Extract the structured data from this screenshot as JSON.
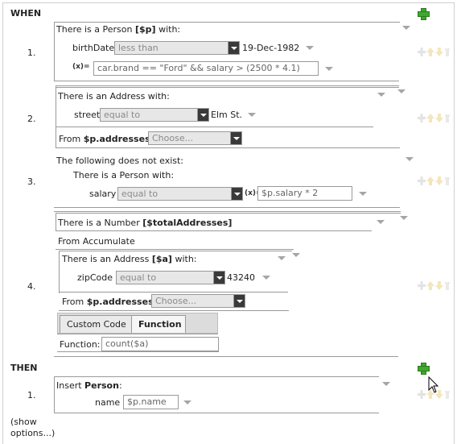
{
  "when_header": "WHEN",
  "then_header": "THEN",
  "rule_numbers": [
    "1.",
    "2.",
    "3.",
    "4."
  ],
  "action_numbers": [
    "1."
  ],
  "r1": {
    "pattern_prefix": "There is a Person ",
    "pattern_var": "[$p]",
    "pattern_suffix": " with:",
    "field": "birthDate",
    "operator": "less than",
    "value": "19-Dec-1982",
    "formula_icon": "(x)=",
    "formula": "car.brand == \"Ford\" && salary > (2500 * 4.1)"
  },
  "r2": {
    "pattern_text": "There is an Address with:",
    "field": "street",
    "operator": "equal to",
    "value": "Elm St.",
    "from_prefix": "From ",
    "from_source": "$p.addresses.",
    "from_choose": "Choose..."
  },
  "r3": {
    "not_exist": "The following does not exist:",
    "pattern_text": "There is a Person with:",
    "field": "salary",
    "operator": "equal to",
    "formula_icon": "(x)=",
    "value": "$p.salary * 2"
  },
  "r4": {
    "number_prefix": "There is a Number ",
    "number_var": "[$totalAddresses]",
    "from_accumulate": "From Accumulate",
    "addr_prefix": "There is an Address ",
    "addr_var": "[$a]",
    "addr_suffix": " with:",
    "field": "zipCode",
    "operator": "equal to",
    "value": "43240",
    "from_prefix": "From ",
    "from_source": "$p.addresses.",
    "from_choose": "Choose...",
    "tab_custom": "Custom Code",
    "tab_function": "Function",
    "function_label": "Function:",
    "function_value": "count($a)"
  },
  "then": {
    "insert_prefix": "Insert ",
    "insert_fact": "Person",
    "insert_suffix": ":",
    "field": "name",
    "value": "$p.name"
  },
  "show_options_1": "(show",
  "show_options_2": "options...)",
  "colors": {
    "add_green": "#3fa82e",
    "dropdown_btn": "#3a3a3a",
    "line_gray": "#9a9a9a"
  },
  "icons": [
    "add-icon",
    "move-up-icon",
    "move-down-icon",
    "delete-icon",
    "dropdown-arrow-icon",
    "formula-icon",
    "mouse-cursor-icon"
  ]
}
